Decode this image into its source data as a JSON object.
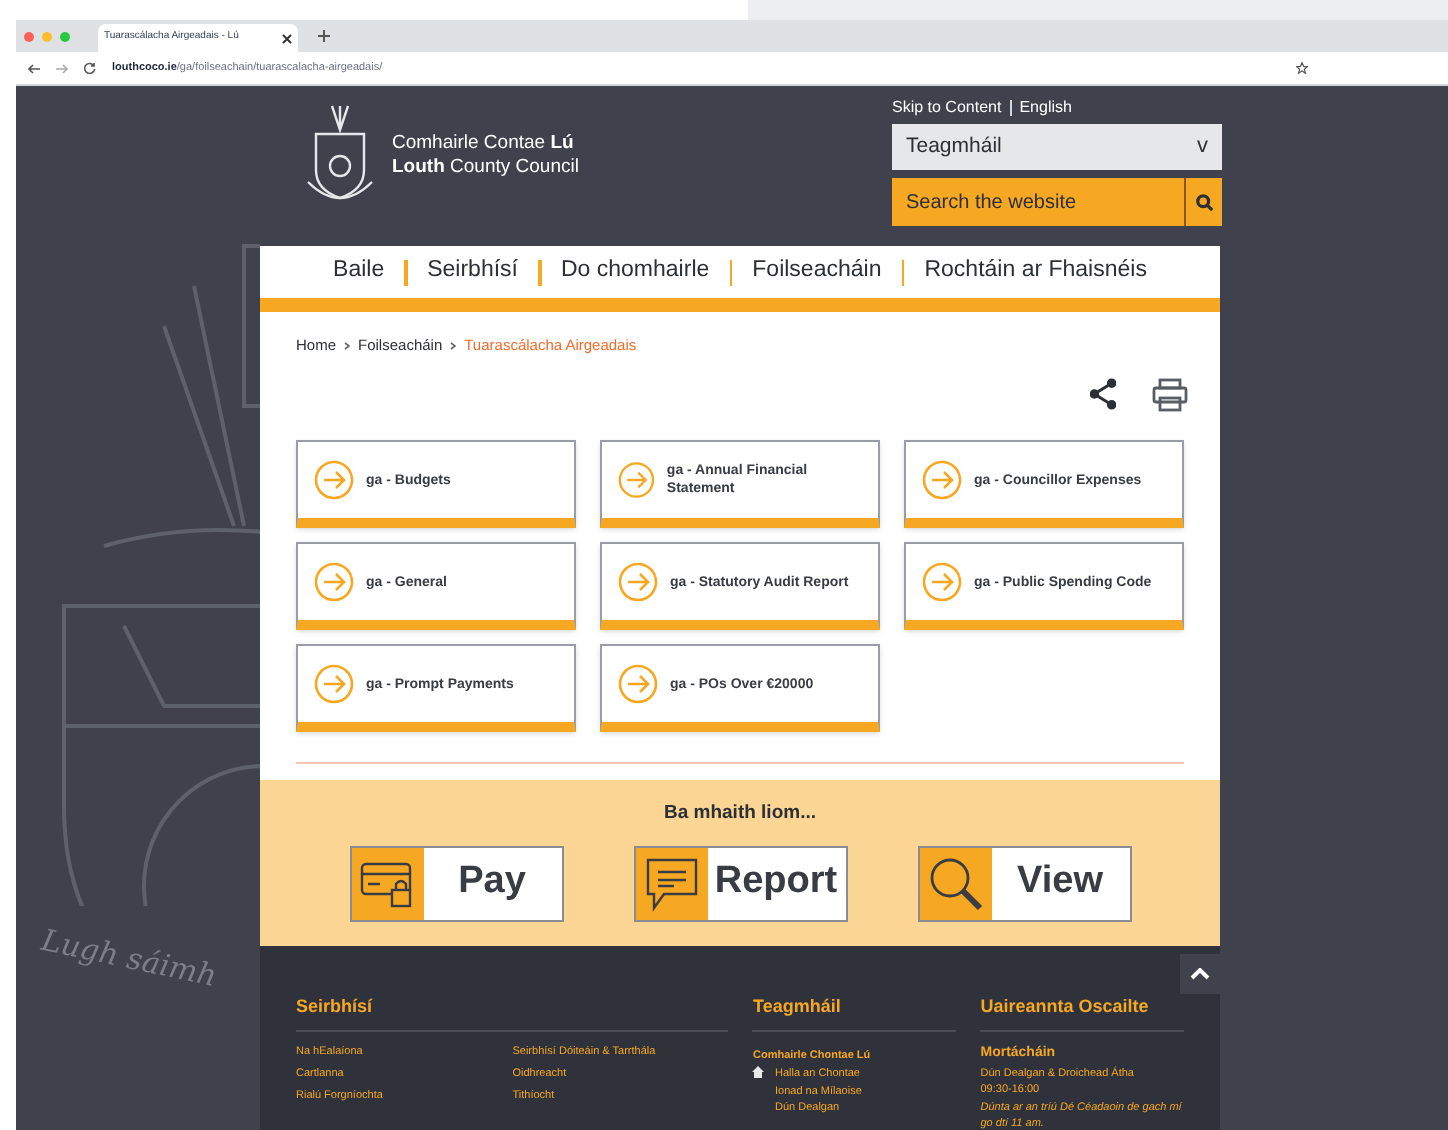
{
  "browser": {
    "tab_title": "Tuarascálacha Airgeadais - Lú",
    "url_domain": "louthcoco.ie",
    "url_path": "/ga/foilseachain/tuarascalacha-airgeadais/"
  },
  "header": {
    "council_name_ga": "Comhairle Contae **Lú**",
    "council_name_en": "**Louth** County Council",
    "skip_link": "Skip to Content",
    "language_link": "English",
    "dropdown": {
      "value": "Teagmháil",
      "caret": "v"
    },
    "search": {
      "placeholder": "Search the website"
    }
  },
  "crest_motto": "Lugh sáimh",
  "nav": [
    "Baile",
    "Seirbhísí",
    "Do chomhairle",
    "Foilseacháin",
    "Rochtáin ar Fhaisnéis"
  ],
  "breadcrumb": [
    {
      "label": "Home",
      "current": false
    },
    {
      "label": "Foilseacháin",
      "current": false
    },
    {
      "label": "Tuarascálacha Airgeadais",
      "current": true
    }
  ],
  "cards": [
    {
      "label": "ga - Budgets"
    },
    {
      "label": "ga - Annual Financial Statement"
    },
    {
      "label": "ga - Councillor Expenses"
    },
    {
      "label": "ga - General"
    },
    {
      "label": "ga - Statutory Audit Report"
    },
    {
      "label": "ga - Public Spending Code"
    },
    {
      "label": "ga - Prompt Payments"
    },
    {
      "label": "ga - POs Over €20000"
    }
  ],
  "quick_actions": {
    "heading": "Ba mhaith liom...",
    "buttons": [
      {
        "label": "Pay",
        "kind": "card"
      },
      {
        "label": "Report",
        "kind": "speech"
      },
      {
        "label": "View",
        "kind": "magnifier"
      }
    ]
  },
  "footer": {
    "services": {
      "heading": "Seirbhísí",
      "links": [
        "Na hEalaíona",
        "Seirbhísí Dóiteáin & Tarrthála",
        "Cartlanna",
        "Oidhreacht",
        "Rialú Forgníochta",
        "Tithíocht"
      ]
    },
    "contact": {
      "heading": "Teagmháil",
      "name": "Comhairle Chontae Lú",
      "address": [
        "Halla an Chontae",
        "Ionad na Mílaoise",
        "Dún Dealgan"
      ]
    },
    "hours": {
      "heading": "Uaireannta Oscailte",
      "title": "Mortácháin",
      "place": "Dún Dealgan & Droichead Átha",
      "time": "09:30-16:00",
      "note": "Dúnta ar an tríú Dé Céadaoin de gach mí go dtí 11 am."
    }
  }
}
